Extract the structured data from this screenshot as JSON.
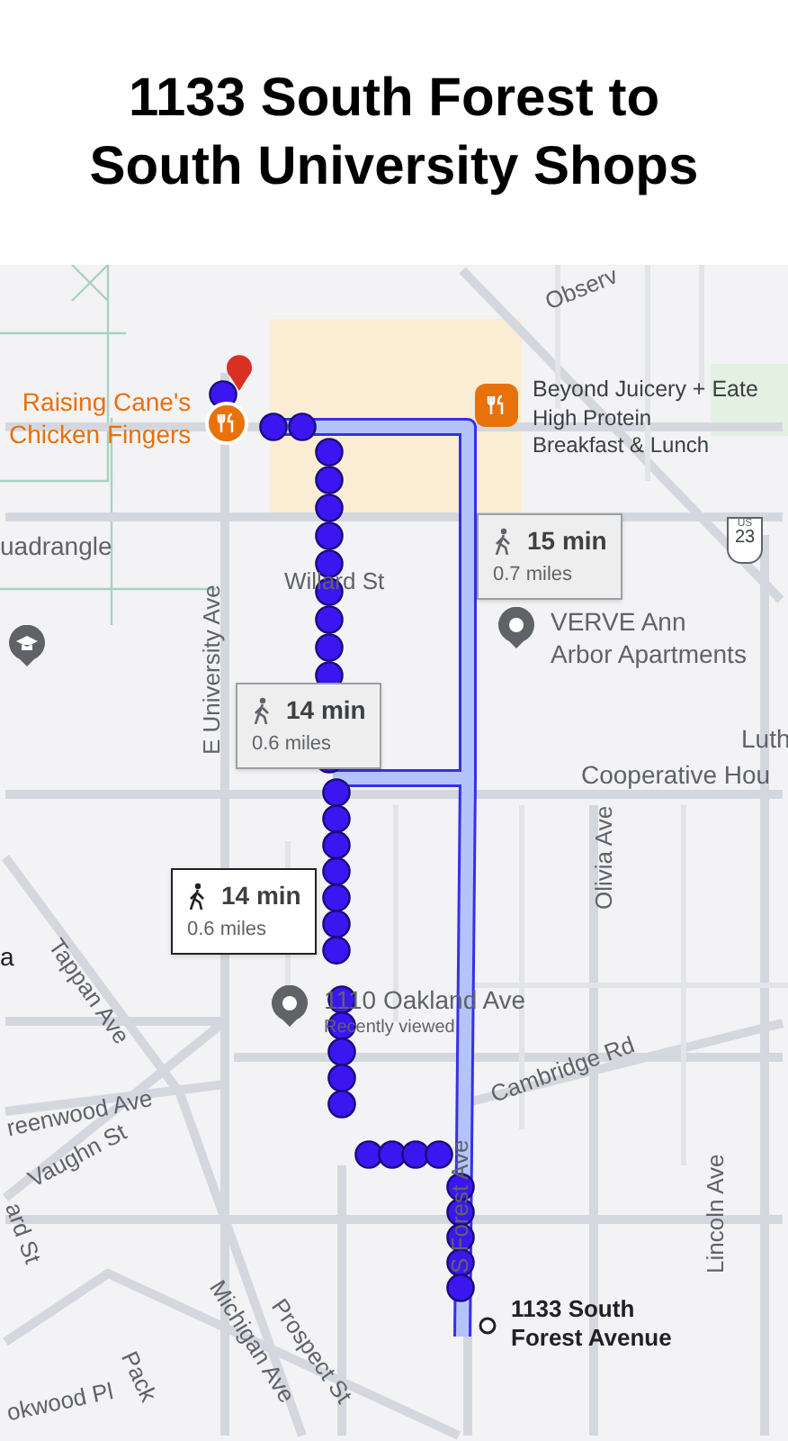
{
  "title_lines": [
    "1133 South Forest to",
    "South University Shops"
  ],
  "map": {
    "streets": [
      {
        "text": "Observ"
      },
      {
        "text": "E University Ave"
      },
      {
        "text": "Willard St"
      },
      {
        "text": "Olivia Ave"
      },
      {
        "text": "Tappan Ave"
      },
      {
        "text": "Cambridge Rd"
      },
      {
        "text": "reenwood Ave"
      },
      {
        "text": "Vaughn St"
      },
      {
        "text": "ard St"
      },
      {
        "text": "Prospect St"
      },
      {
        "text": "Michigan Ave"
      },
      {
        "text": "S Forest Ave"
      },
      {
        "text": "Lincoln Ave"
      },
      {
        "text": "okwood Pl"
      },
      {
        "text": "Pack"
      }
    ],
    "places": [
      {
        "kind": "restaurant",
        "name": "Raising Cane's\nChicken Fingers"
      },
      {
        "kind": "restaurant",
        "name": "Beyond Juicery + Eate",
        "subtitle": "High Protein\nBreakfast & Lunch"
      },
      {
        "kind": "pin",
        "name": "VERVE Ann\nArbor Apartments"
      },
      {
        "kind": "pin",
        "name": "1110 Oakland Ave",
        "subtitle": "Recently viewed"
      },
      {
        "kind": "text",
        "name": "uadrangle"
      },
      {
        "kind": "school"
      },
      {
        "kind": "text",
        "name": "Luth"
      },
      {
        "kind": "text",
        "name": "Cooperative Hou"
      },
      {
        "kind": "text",
        "name": "a"
      },
      {
        "kind": "destination",
        "name": "1133 South\nForest Avenue"
      }
    ],
    "highway": {
      "network": "US",
      "number": "23"
    },
    "routes": [
      {
        "time": "15 min",
        "distance": "0.7 miles",
        "selected": false
      },
      {
        "time": "14 min",
        "distance": "0.6 miles",
        "selected": false
      },
      {
        "time": "14 min",
        "distance": "0.6 miles",
        "selected": true
      }
    ]
  }
}
